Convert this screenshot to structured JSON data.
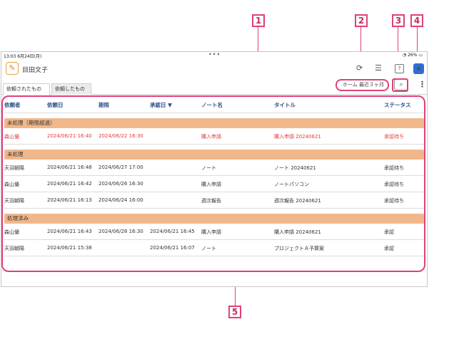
{
  "callouts": [
    "1",
    "2",
    "3",
    "4",
    "5"
  ],
  "status_bar": {
    "time": "13:03",
    "date": "6月24日(月)",
    "dots": "•••",
    "battery": "26%"
  },
  "app": {
    "name": "目田文子"
  },
  "icons": {
    "app": "note-app-icon",
    "sync": "sync-icon",
    "menu": "hamburger-menu-icon",
    "help": "help-icon",
    "user": "user-icon"
  },
  "tabs": [
    "依頼されたもの",
    "依頼したもの"
  ],
  "filter": {
    "label": "ホーム 最近３ヶ月"
  },
  "columns": [
    "依頼者",
    "依頼日",
    "期限",
    "承認日 ▼",
    "ノート名",
    "タイトル",
    "ステータス"
  ],
  "colors": {
    "callout": "#e0407a",
    "group_header": "#f0b88a",
    "overdue_text": "#e03b3b",
    "column_header": "#2a4f8a"
  },
  "groups": [
    {
      "title": "未処理（期限超過）",
      "rows": [
        {
          "requester": "森山優",
          "requested": "2024/06/21 16:40",
          "deadline": "2024/06/22 16:30",
          "approved": "",
          "note": "購入申請",
          "title": "購入申請 20240621",
          "status": "承認待ち",
          "overdue": true
        }
      ]
    },
    {
      "title": "未処理",
      "rows": [
        {
          "requester": "天羽朝陽",
          "requested": "2024/06/21 16:48",
          "deadline": "2024/06/27 17:00",
          "approved": "",
          "note": "ノート",
          "title": "ノート 20240621",
          "status": "承認待ち"
        },
        {
          "requester": "森山優",
          "requested": "2024/06/21 16:42",
          "deadline": "2024/06/26 16:30",
          "approved": "",
          "note": "購入申請",
          "title": "ノートパソコン",
          "status": "承認待ち"
        },
        {
          "requester": "天羽朝陽",
          "requested": "2024/06/21 16:13",
          "deadline": "2024/06/24 16:00",
          "approved": "",
          "note": "週次報告",
          "title": "週次報告 20240621",
          "status": "承認待ち"
        }
      ]
    },
    {
      "title": "処理済み",
      "rows": [
        {
          "requester": "森山優",
          "requested": "2024/06/21 16:43",
          "deadline": "2024/06/28 16:30",
          "approved": "2024/06/21 16:45",
          "note": "購入申請",
          "title": "購入申請 20240621",
          "status": "承認"
        },
        {
          "requester": "天羽朝陽",
          "requested": "2024/06/21 15:38",
          "deadline": "",
          "approved": "2024/06/21 16:07",
          "note": "ノート",
          "title": "プロジェクトＡ予算案",
          "status": "承認"
        }
      ]
    }
  ]
}
